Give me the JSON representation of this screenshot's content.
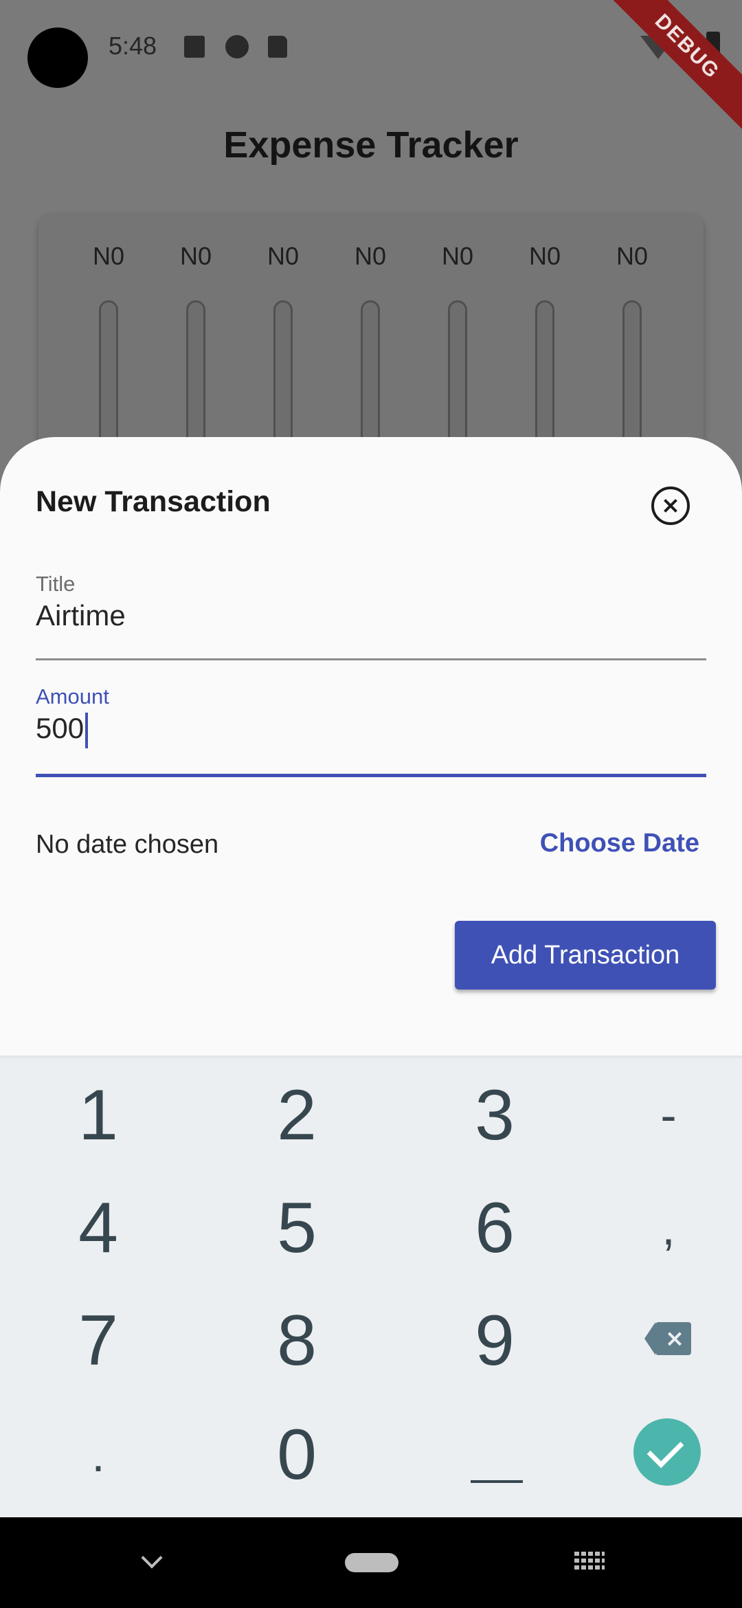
{
  "status_bar": {
    "time": "5:48"
  },
  "debug_banner": "DEBUG",
  "app": {
    "title": "Expense Tracker",
    "chart_labels": [
      "N0",
      "N0",
      "N0",
      "N0",
      "N0",
      "N0",
      "N0"
    ]
  },
  "sheet": {
    "title": "New Transaction",
    "title_field": {
      "label": "Title",
      "value": "Airtime"
    },
    "amount_field": {
      "label": "Amount",
      "value": "500"
    },
    "date_status": "No date chosen",
    "choose_date_label": "Choose Date",
    "submit_label": "Add Transaction"
  },
  "keyboard": {
    "row1": [
      "1",
      "2",
      "3",
      "-"
    ],
    "row2": [
      "4",
      "5",
      "6",
      ","
    ],
    "row3": [
      "7",
      "8",
      "9"
    ],
    "row4": [
      ".",
      "0",
      "_"
    ]
  },
  "colors": {
    "primary": "#3f51b5",
    "keyboard_bg": "#eceff1",
    "key_text": "#37474f",
    "done_key": "#4db6ac"
  }
}
